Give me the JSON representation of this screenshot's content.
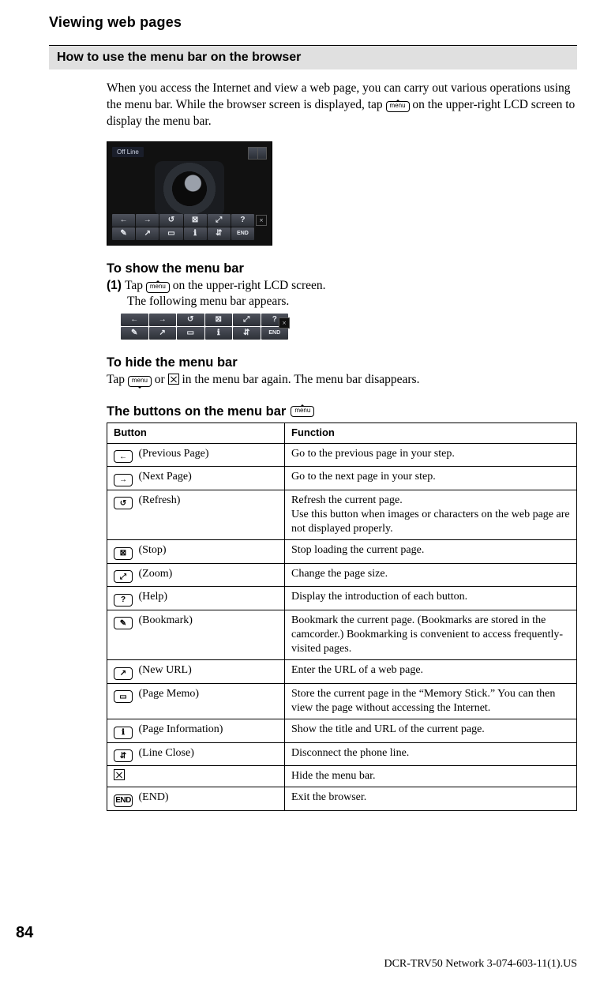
{
  "running_head": "Viewing web pages",
  "section_title": "How to use the menu bar on the browser",
  "intro_pre": "When you access the Internet and view a web page, you can carry out various operations using the menu bar. While the browser screen is displayed, tap ",
  "intro_post": " on the upper-right LCD screen to display the menu bar.",
  "menu_button_label": "menu",
  "lcd_status": "Off Line",
  "menubar_icons_row1": [
    "←",
    "→",
    "↺",
    "⊠",
    "⤢",
    "?"
  ],
  "menubar_icons_row2": [
    "✎",
    "↗",
    "▭",
    "ℹ",
    "⇵",
    "END"
  ],
  "close_icon_label": "×",
  "show_heading": "To show the menu bar",
  "show_step_num": "(1)",
  "show_step_pre": "Tap ",
  "show_step_post": " on the upper-right LCD screen.",
  "show_step_line2": "The following menu bar appears.",
  "hide_heading": "To hide the menu bar",
  "hide_pre": "Tap ",
  "hide_mid": " or ",
  "hide_post": " in the menu bar again. The menu bar disappears.",
  "table_title": "The buttons on the menu bar",
  "table": {
    "headers": [
      "Button",
      "Function"
    ],
    "rows": [
      {
        "icon": "←",
        "name": "(Previous Page)",
        "func": "Go to the previous page in your step."
      },
      {
        "icon": "→",
        "name": "(Next Page)",
        "func": "Go to the next page in your step."
      },
      {
        "icon": "↺",
        "name": "(Refresh)",
        "func": "Refresh the current page.\nUse this button when images or characters on the web page are not displayed properly."
      },
      {
        "icon": "⊠",
        "name": "(Stop)",
        "func": "Stop loading the current page."
      },
      {
        "icon": "⤢",
        "name": "(Zoom)",
        "func": "Change the page size."
      },
      {
        "icon": "?",
        "name": "(Help)",
        "func": "Display the introduction of each button."
      },
      {
        "icon": "✎",
        "name": "(Bookmark)",
        "func": "Bookmark the current page. (Bookmarks are stored in the camcorder.) Bookmarking is convenient to access frequently-visited pages."
      },
      {
        "icon": "↗",
        "name": "(New URL)",
        "func": "Enter the URL of a web page."
      },
      {
        "icon": "▭",
        "name": "(Page Memo)",
        "func": "Store the current page in the “Memory Stick.” You can then view the page without accessing the Internet."
      },
      {
        "icon": "ℹ",
        "name": "(Page Information)",
        "func": "Show the title and URL of the current page."
      },
      {
        "icon": "⇵",
        "name": "(Line Close)",
        "func": "Disconnect the phone line."
      },
      {
        "icon": "X",
        "name": "",
        "func": "Hide the menu bar."
      },
      {
        "icon": "END",
        "name": "(END)",
        "func": "Exit the browser."
      }
    ]
  },
  "page_number": "84",
  "footer": "DCR-TRV50 Network 3-074-603-11(1).US"
}
